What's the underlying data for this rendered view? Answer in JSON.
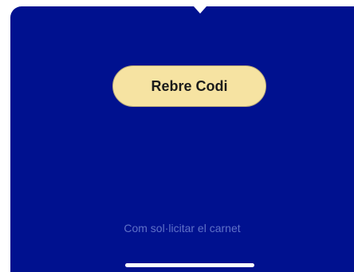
{
  "main": {
    "primary_button_label": "Rebre Codi",
    "help_link_text": "Com sol·licitar el carnet"
  },
  "colors": {
    "background": "#00118F",
    "button_fill": "#F6E3A2",
    "link_text": "#5F71C8",
    "home_indicator": "#FFFFFF"
  }
}
